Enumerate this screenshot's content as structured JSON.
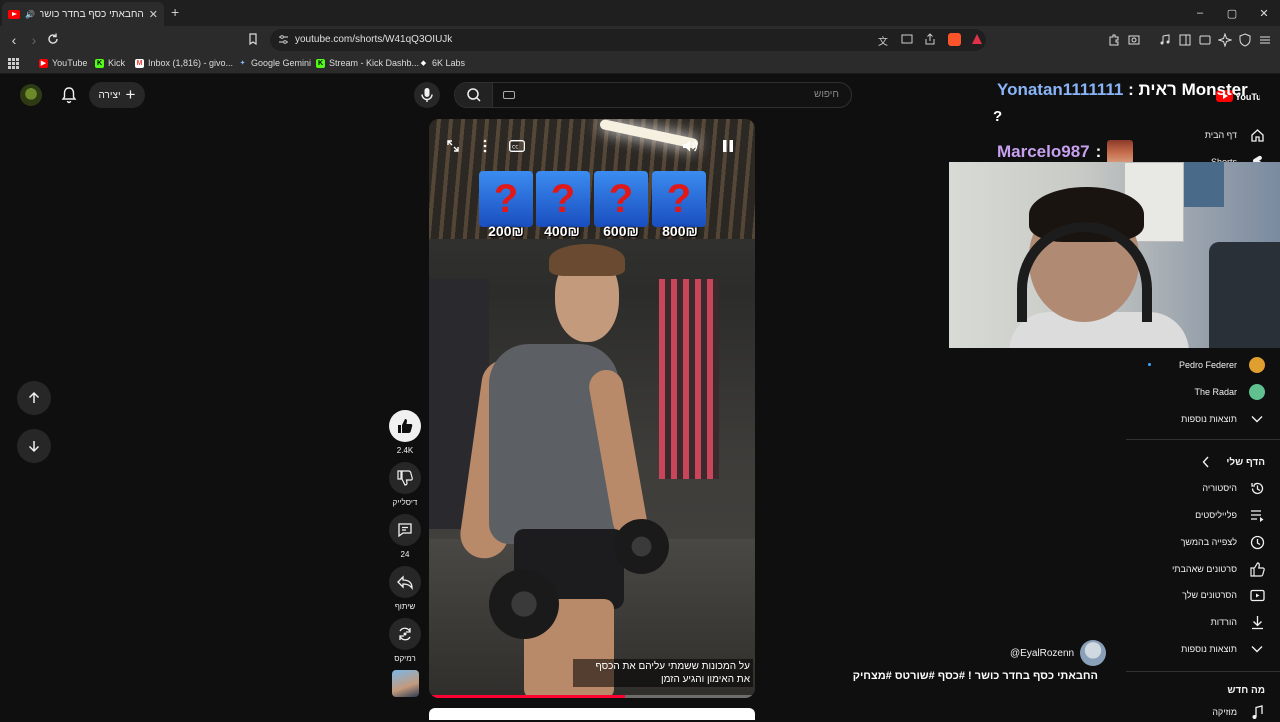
{
  "browser": {
    "tab_title": "החבאתי כסף בחדר כושר ! #כ...",
    "new_tab": "+",
    "window_controls": [
      "–",
      "▢",
      "✕"
    ],
    "url": "youtube.com/shorts/W41qQ3OIUJk",
    "bookmarks": [
      {
        "label": "YouTube",
        "color": "#ff0000",
        "glyph": "▶"
      },
      {
        "label": "Kick",
        "color": "#53fc18",
        "glyph": "K"
      },
      {
        "label": "Inbox (1,816) - givo...",
        "color": "#ea4335",
        "glyph": "M"
      },
      {
        "label": "Google Gemini",
        "color": "#8ab4f8",
        "glyph": "✦"
      },
      {
        "label": "Stream - Kick Dashb...",
        "color": "#53fc18",
        "glyph": "K"
      },
      {
        "label": "6K Labs",
        "color": "#ffffff",
        "glyph": "◆"
      }
    ]
  },
  "header": {
    "create_label": "יצירה",
    "search_placeholder": "חיפוש"
  },
  "short": {
    "quiz_prices": [
      "200₪",
      "400₪",
      "600₪",
      "800₪"
    ],
    "quiz_mark": "?",
    "subtitle_line1": "על המכונות ששמתי עליהם את הכסף",
    "subtitle_line2": "את האימון והגיע הזמן",
    "progress": 0.6
  },
  "actions": {
    "like_count": "2.4K",
    "dislike_label": "דיסלייק",
    "comment_count": "24",
    "share_label": "שיתוף",
    "remix_label": "רמיקס"
  },
  "channel": {
    "handle": "@EyalRozenn",
    "video_title": "החבאתי כסף בחדר כושר ! #כסף #שורטס #מצחיק"
  },
  "sidebar": {
    "home": "דף הבית",
    "shorts": "Shorts",
    "subscriptions": [
      {
        "name": "Pedro Federer",
        "color": "#e0a030"
      },
      {
        "name": "The Radar",
        "color": "#60c090"
      }
    ],
    "more_results_1": "תוצאות נוספות",
    "my_page": "הדף שלי",
    "history": "היסטוריה",
    "playlists": "פלייליסטים",
    "watch_later": "לצפייה בהמשך",
    "liked": "סרטונים שאהבתי",
    "your_videos": "הסרטונים שלך",
    "downloads": "הורדות",
    "more_results_2": "תוצאות נוספות",
    "whats_new": "מה חדש",
    "music": "מוזיקה"
  },
  "stream_overlay": {
    "chat1_user": "Yonatan1111111",
    "chat1_sep": " : ",
    "chat1_msg": "ראית Monster",
    "chat1_q": "?",
    "chat2_user": "Marcelo987",
    "chat2_sep": " :",
    "user1_color": "#8ab4f8",
    "user2_color": "#c8a0f0"
  }
}
